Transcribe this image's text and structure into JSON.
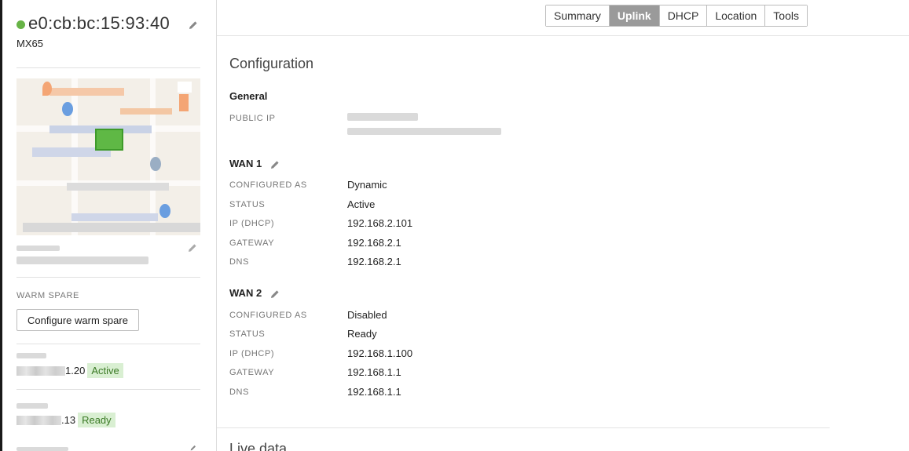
{
  "device": {
    "mac": "e0:cb:bc:15:93:40",
    "model": "MX65",
    "status_color": "#67b346"
  },
  "sidebar": {
    "warm_spare_label": "WARM SPARE",
    "configure_warm_spare": "Configure warm spare",
    "wan1_ip_suffix": "1.20",
    "wan1_badge": "Active",
    "wan2_ip_suffix": ".13",
    "wan2_badge": "Ready"
  },
  "tabs": [
    {
      "label": "Summary",
      "active": false
    },
    {
      "label": "Uplink",
      "active": true
    },
    {
      "label": "DHCP",
      "active": false
    },
    {
      "label": "Location",
      "active": false
    },
    {
      "label": "Tools",
      "active": false
    }
  ],
  "main": {
    "title": "Configuration",
    "general": {
      "heading": "General",
      "public_ip_label": "PUBLIC IP"
    },
    "wan1": {
      "heading": "WAN 1",
      "rows": [
        {
          "key": "CONFIGURED AS",
          "value": "Dynamic"
        },
        {
          "key": "STATUS",
          "value": "Active"
        },
        {
          "key": "IP (DHCP)",
          "value": "192.168.2.101"
        },
        {
          "key": "GATEWAY",
          "value": "192.168.2.1"
        },
        {
          "key": "DNS",
          "value": "192.168.2.1"
        }
      ]
    },
    "wan2": {
      "heading": "WAN 2",
      "rows": [
        {
          "key": "CONFIGURED AS",
          "value": "Disabled"
        },
        {
          "key": "STATUS",
          "value": "Ready"
        },
        {
          "key": "IP (DHCP)",
          "value": "192.168.1.100"
        },
        {
          "key": "GATEWAY",
          "value": "192.168.1.1"
        },
        {
          "key": "DNS",
          "value": "192.168.1.1"
        }
      ]
    },
    "live_title": "Live data"
  },
  "icons": {
    "edit": "pencil-icon",
    "map_pin": "map-pin-icon"
  },
  "colors": {
    "active_tab_bg": "#9a9a9a",
    "badge_bg": "#d9efd2",
    "badge_text": "#3b7a25"
  }
}
